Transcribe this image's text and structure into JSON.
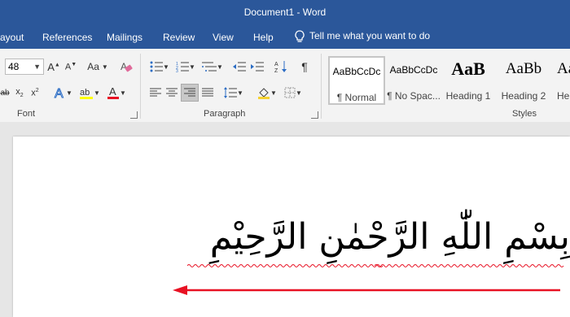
{
  "window": {
    "title": "Document1  -  Word"
  },
  "tabs": [
    {
      "label": "ayout"
    },
    {
      "label": "References"
    },
    {
      "label": "Mailings"
    },
    {
      "label": "Review"
    },
    {
      "label": "View"
    },
    {
      "label": "Help"
    }
  ],
  "tell_me": {
    "label": "Tell me what you want to do"
  },
  "font_group": {
    "label": "Font",
    "size_value": "48",
    "case_label": "Aa"
  },
  "paragraph_group": {
    "label": "Paragraph"
  },
  "styles_group": {
    "label": "Styles",
    "items": [
      {
        "preview": "AaBbCcDc",
        "name": "¶ Normal"
      },
      {
        "preview": "AaBbCcDc",
        "name": "¶ No Spac..."
      },
      {
        "preview": "AaB",
        "name": "Heading 1"
      },
      {
        "preview": "AaBb",
        "name": "Heading 2"
      },
      {
        "preview": "AaBb",
        "name": "He"
      }
    ]
  },
  "document": {
    "text": "بِسْمِ اللّٰهِ الرَّحْمٰنِ الرَّحِيْمِ"
  },
  "colors": {
    "accent": "#2b579a",
    "arrow": "#e81123",
    "squiggle": "#e81123"
  }
}
